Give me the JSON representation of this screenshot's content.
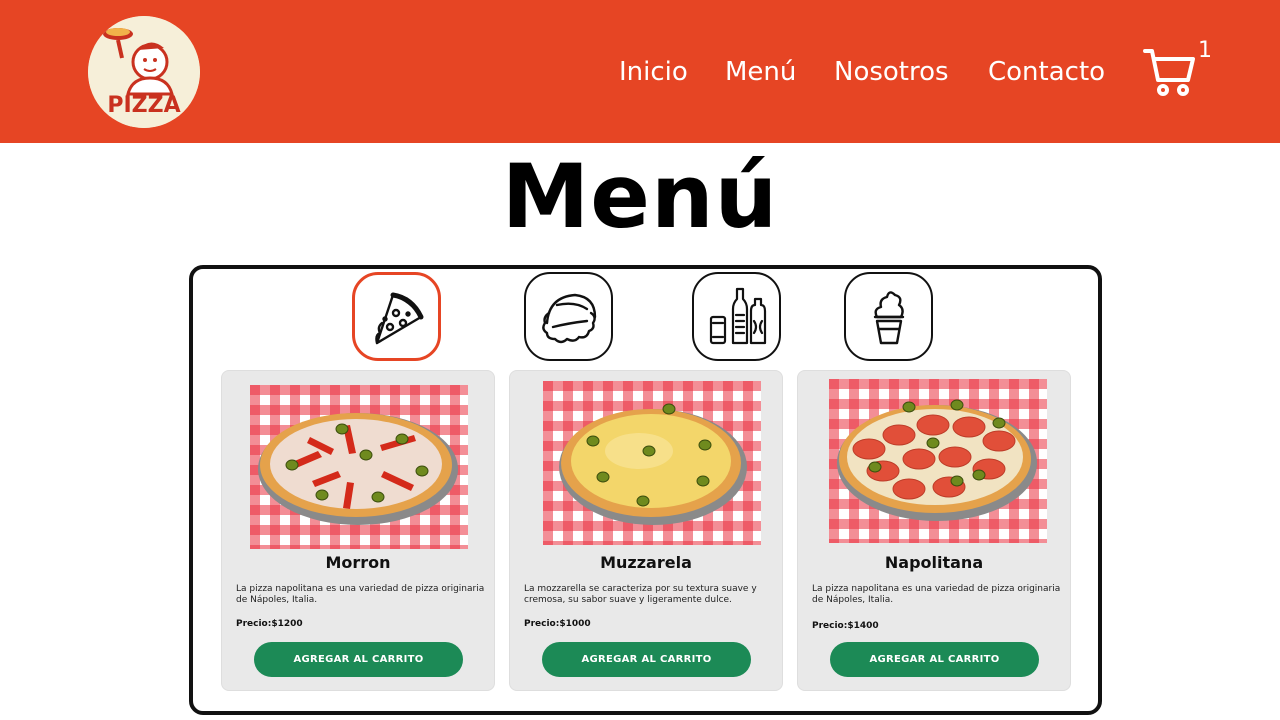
{
  "header": {
    "logo_text": "PIZZA",
    "nav": [
      {
        "label": "Inicio"
      },
      {
        "label": "Menú"
      },
      {
        "label": "Nosotros"
      },
      {
        "label": "Contacto"
      }
    ],
    "cart_icon": "shopping-cart-icon",
    "cart_count": "1"
  },
  "page_title": "Menú",
  "categories": [
    {
      "icon": "pizza-slice-icon",
      "active": true
    },
    {
      "icon": "empanada-icon",
      "active": false
    },
    {
      "icon": "drinks-icon",
      "active": false
    },
    {
      "icon": "ice-cream-icon",
      "active": false
    }
  ],
  "products": [
    {
      "name": "Morron",
      "description": "La pizza napolitana es una variedad de pizza originaria de Nápoles, Italia.",
      "price_label": "Precio:",
      "price": "$1200",
      "button": "AGREGAR AL CARRITO"
    },
    {
      "name": "Muzzarela",
      "description": "La mozzarella se caracteriza por su textura suave y cremosa, su sabor suave y ligeramente dulce.",
      "price_label": "Precio:",
      "price": "$1000",
      "button": "AGREGAR AL CARRITO"
    },
    {
      "name": "Napolitana",
      "description": "La pizza napolitana es una variedad de pizza originaria de Nápoles, Italia.",
      "price_label": "Precio:",
      "price": "$1400",
      "button": "AGREGAR AL CARRITO"
    }
  ],
  "colors": {
    "brand": "#e64524",
    "button": "#1c8a56",
    "card_bg": "#e9e9e9"
  }
}
